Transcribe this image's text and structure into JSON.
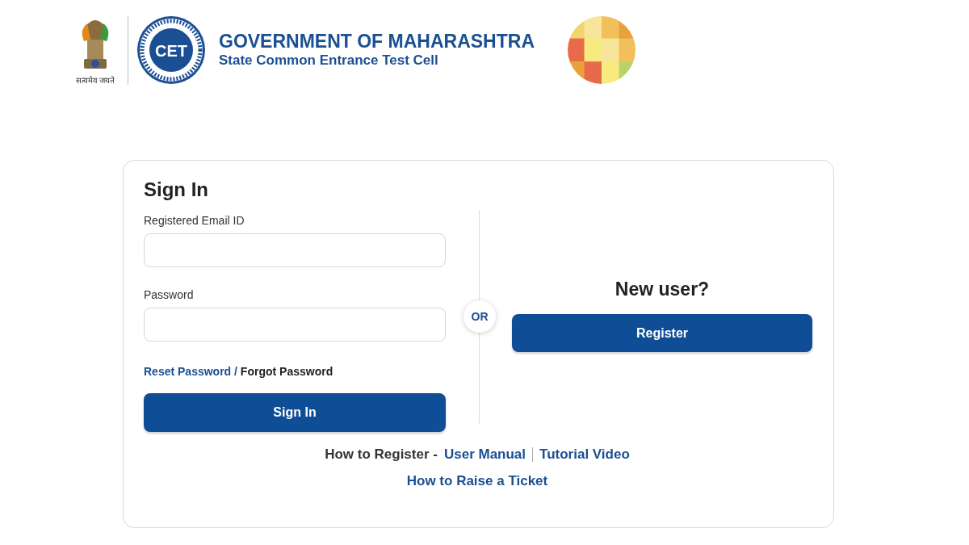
{
  "header": {
    "emblem_motto": "सत्यमेव जयते",
    "seal_mark": "CET",
    "title": "GOVERNMENT OF MAHARASHTRA",
    "subtitle": "State Common Entrance Test Cell"
  },
  "sign_in": {
    "heading": "Sign In",
    "fields": [
      {
        "label": "Registered Email ID"
      },
      {
        "label": "Password"
      }
    ],
    "reset_link": "Reset Password",
    "separator": "/",
    "forgot_link": "Forgot Password",
    "button": "Sign In"
  },
  "divider_label": "OR",
  "new_user": {
    "heading": "New user?",
    "button": "Register"
  },
  "help": {
    "prefix": "How to Register -",
    "links": [
      "User Manual",
      "Tutorial Video"
    ],
    "ticket_link": "How to Raise a Ticket"
  }
}
